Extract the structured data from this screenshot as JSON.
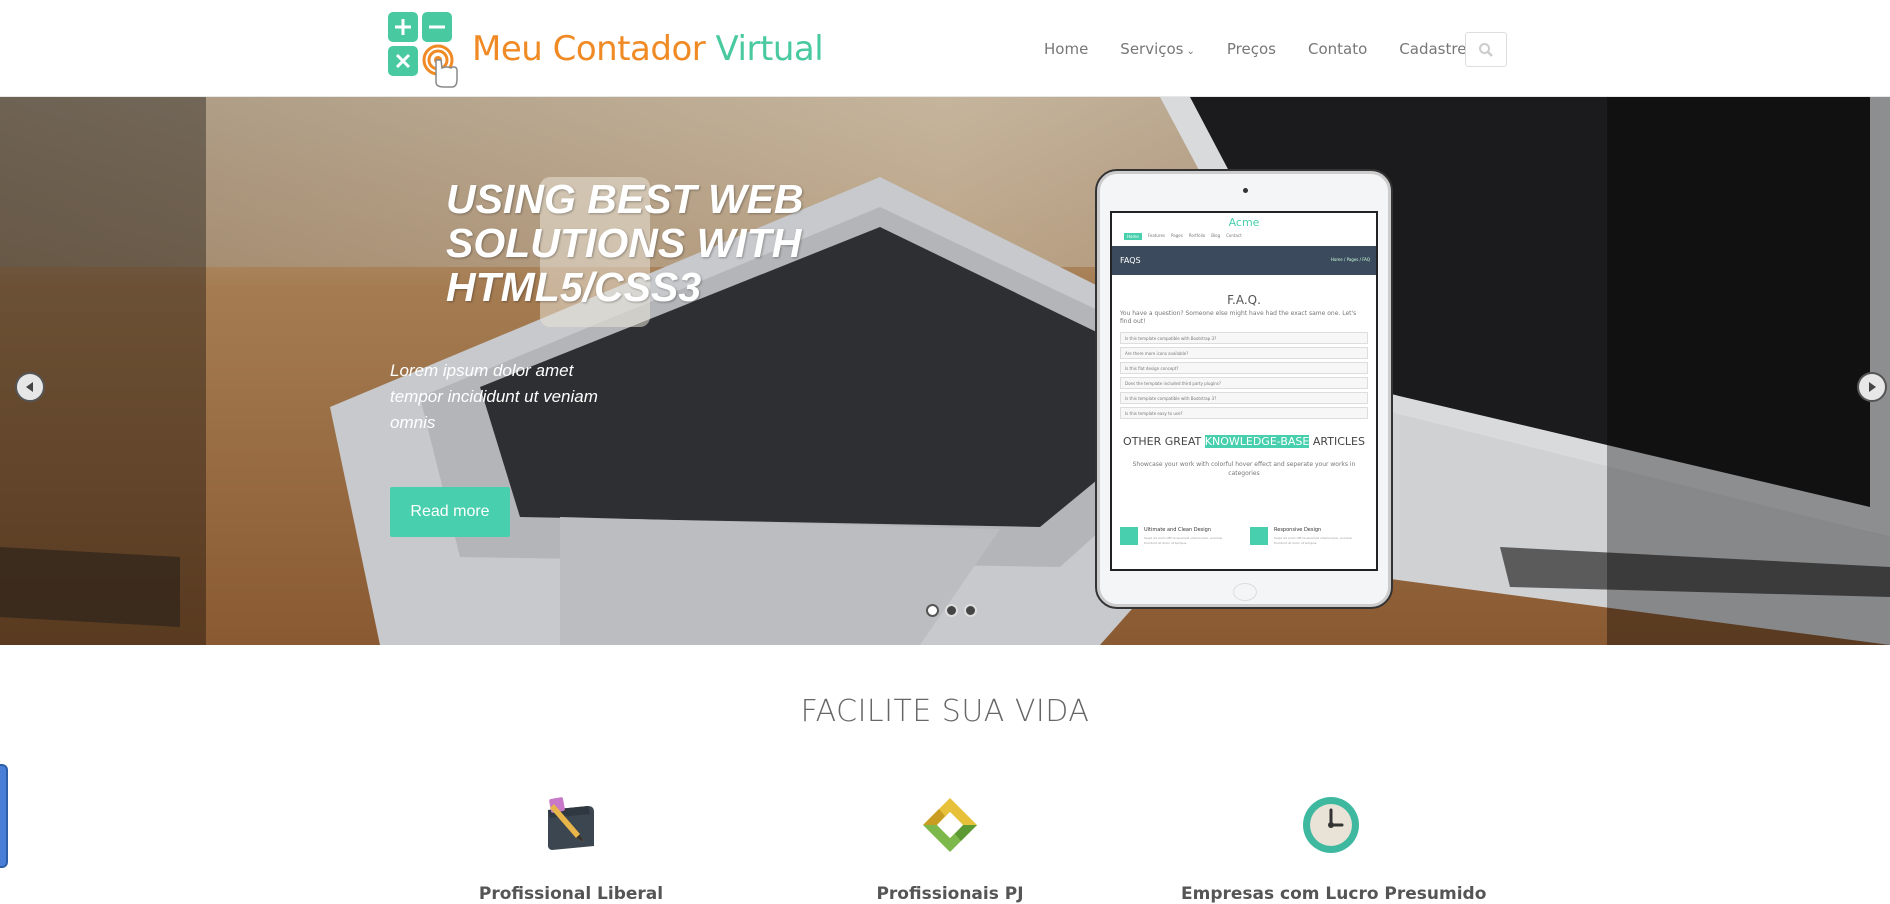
{
  "brand": {
    "name_part1": "Meu Contador ",
    "name_part2": "Virtual"
  },
  "nav": {
    "items": [
      {
        "label": "Home"
      },
      {
        "label": "Serviços",
        "has_dropdown": true
      },
      {
        "label": "Preços"
      },
      {
        "label": "Contato"
      },
      {
        "label": "Cadastre-se"
      }
    ],
    "search_icon": "search-icon"
  },
  "hero": {
    "title": "USING BEST WEB SOLUTIONS WITH HTML5/CSS3",
    "subtitle": "Lorem ipsum dolor amet tempor incididunt ut veniam omnis",
    "button": "Read more",
    "slides": 3,
    "active_slide": 0
  },
  "mockup": {
    "brand": "Acme",
    "nav": [
      "Home",
      "Features",
      "Pages",
      "Portfolio",
      "Blog",
      "Contact"
    ],
    "band_title": "FAQS",
    "breadcrumb": "Home / Pages / FAQ",
    "heading": "F.A.Q.",
    "intro": "You have a question? Someone else might have had the exact same one. Let's find out!",
    "questions": [
      "Is this template compatible with Bootstrap 3?",
      "Are there more icons available?",
      "Is this flat design concept?",
      "Does the template included third party plugins?",
      "Is this template compatible with Bootstrap 3?",
      "Is this template easy to use?"
    ],
    "articles_pre": "OTHER GREAT ",
    "articles_hl": "KNOWLEDGE-BASE",
    "articles_post": " ARTICLES",
    "articles_desc": "Showcase your work with colorful hover effect and seperate your works in categories",
    "features": [
      {
        "title": "Ultimate and Clean Design",
        "desc": "Sequi ad enim officia eiusmod ullamcorper, pulvinar tincidunt at dolor ut tempus."
      },
      {
        "title": "Responsive Design",
        "desc": "Sequi ad enim officia eiusmod ullamcorper, pulvinar tincidunt at dolor ut tempus."
      }
    ]
  },
  "section": {
    "title": "FACILITE SUA VIDA",
    "features": [
      {
        "label": "Profissional Liberal",
        "icon": "pencil-document-icon"
      },
      {
        "label": "Profissionais PJ",
        "icon": "exchange-icon"
      },
      {
        "label": "Empresas com Lucro Presumido",
        "icon": "clock-icon"
      }
    ]
  },
  "colors": {
    "accent": "#48cfad",
    "brand_orange": "#f08a24",
    "brand_green": "#48c9a0"
  }
}
